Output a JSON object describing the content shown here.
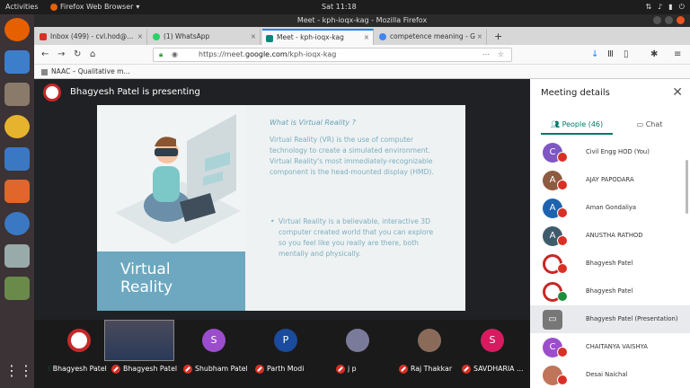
{
  "os": {
    "activities": "Activities",
    "app_name": "Firefox Web Browser",
    "clock": "Sat 11:18"
  },
  "window": {
    "title": "Meet - kph-ioqx-kag - Mozilla Firefox"
  },
  "tabs": [
    {
      "label": "Inbox (499) - cvl.hod@...",
      "color": "#d93025"
    },
    {
      "label": "(1) WhatsApp",
      "color": "#25d366"
    },
    {
      "label": "Meet - kph-ioqx-kag",
      "color": "#00897b"
    },
    {
      "label": "competence meaning - G",
      "color": "#4285f4"
    }
  ],
  "url": {
    "prefix": "https://meet.",
    "domain": "google.com",
    "path": "/kph-ioqx-kag"
  },
  "bookmarks": {
    "item": "NAAC – Qualitative m..."
  },
  "presenter": {
    "text": "Bhagyesh Patel is presenting"
  },
  "slide": {
    "heading": "What is Virtual Reality ?",
    "para": "Virtual Reality (VR) is the use of computer technology to create a simulated environment. Virtual Reality's most immediately-recognizable component is the head-mounted display (HMD).",
    "bullet": "Virtual Reality is a believable, interactive 3D computer created world that you can explore so you feel like you really are there, both mentally and physically.",
    "title_line1": "Virtual",
    "title_line2": "Reality"
  },
  "filmstrip": [
    {
      "name": "Bhagyesh Patel",
      "initial": "",
      "color": "#ffffff"
    },
    {
      "name": "Bhagyesh Patel",
      "initial": "",
      "color": "#556"
    },
    {
      "name": "Shubham Patel",
      "initial": "S",
      "color": "#9c4dcc"
    },
    {
      "name": "Parth Modi",
      "initial": "P",
      "color": "#1a4b9c"
    },
    {
      "name": "j p",
      "initial": "",
      "color": "#7a7a9a"
    },
    {
      "name": "Raj Thakkar",
      "initial": "",
      "color": "#8a6b5a"
    },
    {
      "name": "SAVDHARIA ...",
      "initial": "S",
      "color": "#d81b60"
    }
  ],
  "panel": {
    "title": "Meeting details",
    "people_tab": "People (46)",
    "chat_tab": "Chat"
  },
  "participants": [
    {
      "name": "Civil Engg HOD (You)",
      "initial": "C",
      "color": "#7e57c2"
    },
    {
      "name": "AJAY PAPODARA",
      "initial": "A",
      "color": "#8d5b3f"
    },
    {
      "name": "Aman Gondaliya",
      "initial": "A",
      "color": "#1e63b0"
    },
    {
      "name": "ANUSTHA RATHOD",
      "initial": "A",
      "color": "#3f5b6b"
    },
    {
      "name": "Bhagyesh Patel",
      "initial": "",
      "color": "#ffffff"
    },
    {
      "name": "Bhagyesh Patel",
      "initial": "",
      "color": "#ffffff"
    },
    {
      "name": "Bhagyesh Patel (Presentation)",
      "initial": "",
      "color": "#777777"
    },
    {
      "name": "CHAITANYA VAISHYA",
      "initial": "C",
      "color": "#9c4dcc"
    },
    {
      "name": "Desai Naichal",
      "initial": "",
      "color": "#c0745a"
    }
  ]
}
